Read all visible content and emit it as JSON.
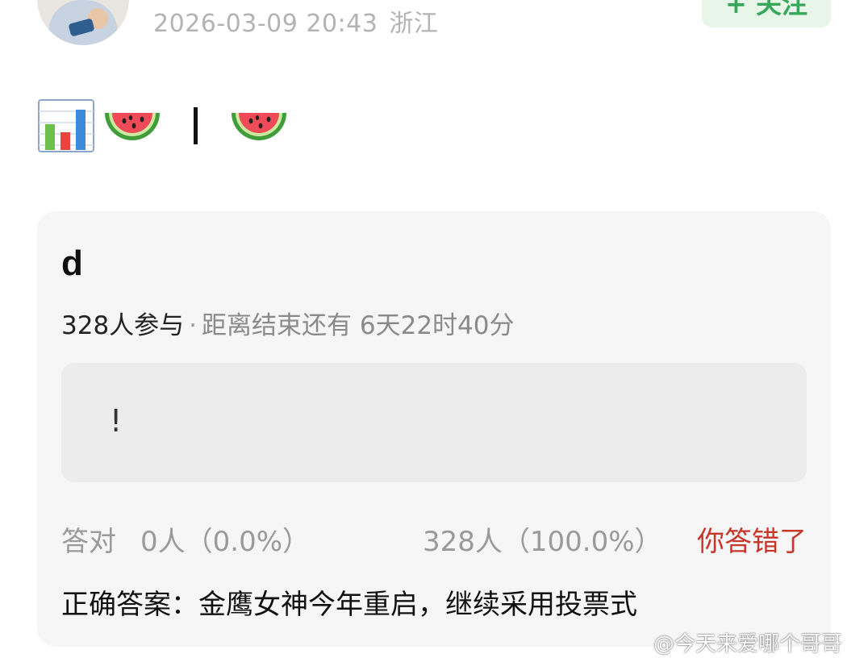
{
  "post": {
    "datetime": "2026-03-09 20:43",
    "location": "浙江",
    "follow_label": "+ 关注",
    "emoji_icons": [
      "bar-chart-icon",
      "watermelon-icon",
      "watermelon-icon"
    ],
    "separator": "|"
  },
  "quiz": {
    "title": "d",
    "participants": "328人参与",
    "separator_dot": "·",
    "deadline_label": "距离结束还有",
    "deadline_value": "6天22时40分",
    "option_text": "!",
    "correct_label": "答对",
    "correct_count": "0人（0.0%）",
    "wrong_count": "328人（100.0%）",
    "status": "你答错了",
    "answer": "正确答案：金鹰女神今年重启，继续采用投票式"
  },
  "watermark": "@今天来爱哪个哥哥",
  "colors": {
    "follow_bg": "#e8f6ea",
    "follow_text": "#37a85a",
    "wrong_status": "#c8362b",
    "card_bg": "#f6f6f6"
  }
}
